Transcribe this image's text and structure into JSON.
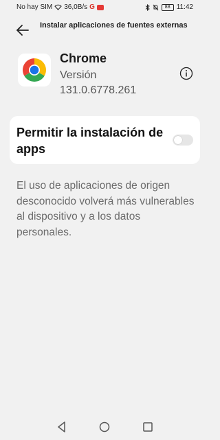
{
  "status_bar": {
    "carrier": "No hay SIM",
    "net_speed": "36,0B/s",
    "notif_badge": "G",
    "battery": "88",
    "time": "11:42"
  },
  "header": {
    "title": "Instalar aplicaciones de fuentes externas"
  },
  "app": {
    "name": "Chrome",
    "version_label": "Versión",
    "version": "131.0.6778.261",
    "icon": "chrome-logo"
  },
  "setting": {
    "label": "Permitir la instalación de apps",
    "enabled": false
  },
  "description": "El uso de aplicaciones de origen desconocido volverá más vulnerables al dispositivo y a los datos personales.",
  "colors": {
    "background": "#f1f1f1",
    "card": "#ffffff",
    "toggle_off": "#e6e6e6",
    "description_text": "#6b6b6b"
  },
  "nav": {
    "icons": [
      "back-triangle-icon",
      "home-circle-icon",
      "recents-square-icon"
    ]
  }
}
